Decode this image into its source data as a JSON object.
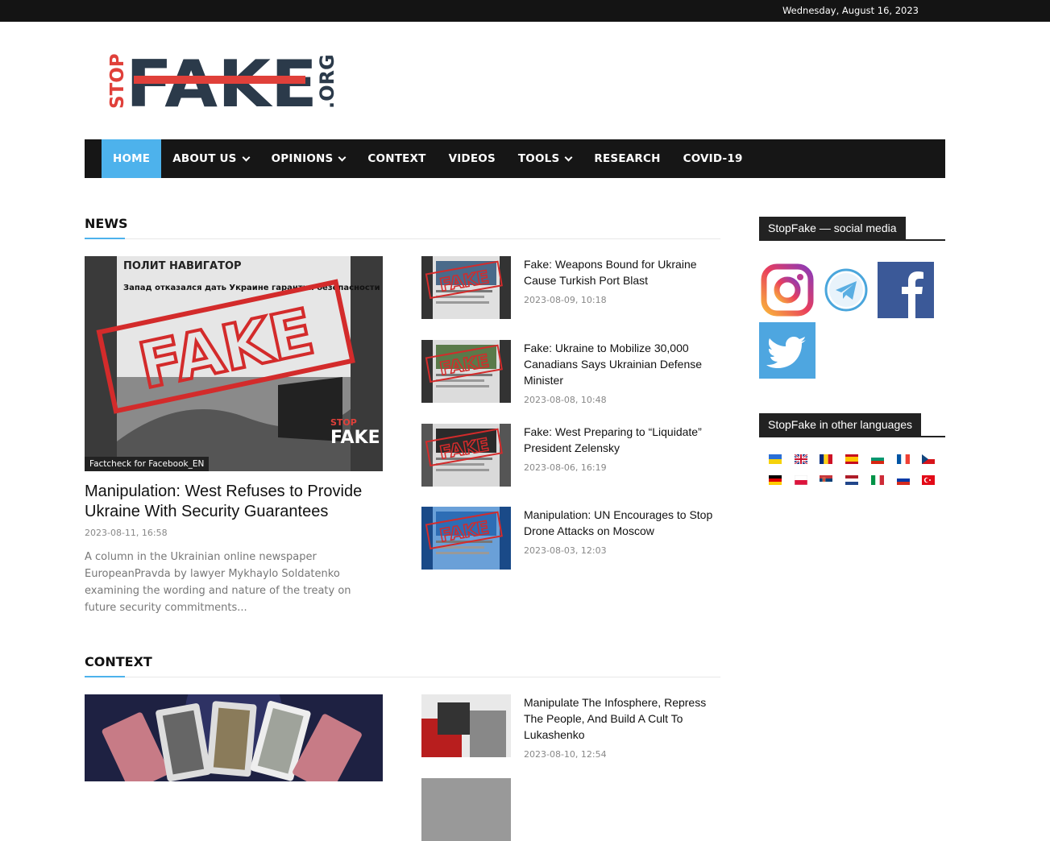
{
  "topbar": {
    "date": "Wednesday, August 16, 2023"
  },
  "logo": {
    "stop": "STOP",
    "fake": "FAKE",
    "org": ".ORG"
  },
  "nav": [
    {
      "label": "HOME",
      "active": true,
      "dropdown": false
    },
    {
      "label": "ABOUT US",
      "active": false,
      "dropdown": true
    },
    {
      "label": "OPINIONS",
      "active": false,
      "dropdown": true
    },
    {
      "label": "CONTEXT",
      "active": false,
      "dropdown": false
    },
    {
      "label": "VIDEOS",
      "active": false,
      "dropdown": false
    },
    {
      "label": "TOOLS",
      "active": false,
      "dropdown": true
    },
    {
      "label": "RESEARCH",
      "active": false,
      "dropdown": false
    },
    {
      "label": "COVID-19",
      "active": false,
      "dropdown": false
    }
  ],
  "news": {
    "section_title": "NEWS",
    "featured": {
      "category": "Factcheck for Facebook_EN",
      "title": "Manipulation: West Refuses to Provide Ukraine With Security Guarantees",
      "date": "2023-08-11, 16:58",
      "excerpt": "A column in the Ukrainian online newspaper EuropeanPravda by lawyer Mykhaylo Soldatenko examining the wording and nature of the treaty on future security commitments...",
      "image_text": {
        "site": "ПОЛИТ НАВИГАТОР",
        "stamp": "FAKE",
        "headline": "Запад отказался дать Украине гарантии безопасности"
      }
    },
    "items": [
      {
        "title": "Fake: Weapons Bound for Ukraine Cause Turkish Port Blast",
        "date": "2023-08-09, 10:18"
      },
      {
        "title": "Fake: Ukraine to Mobilize 30,000 Canadians Says Ukrainian Defense Minister",
        "date": "2023-08-08, 10:48"
      },
      {
        "title": "Fake: West Preparing to “Liquidate” President Zelensky",
        "date": "2023-08-06, 16:19"
      },
      {
        "title": "Manipulation: UN Encourages to Stop Drone Attacks on Moscow",
        "date": "2023-08-03, 12:03"
      }
    ]
  },
  "context": {
    "section_title": "CONTEXT",
    "items": [
      {
        "title": "Manipulate The Infosphere, Repress The People, And Build A Cult To Lukashenko",
        "date": "2023-08-10, 12:54"
      }
    ]
  },
  "sidebar": {
    "social_title": "StopFake — social media",
    "languages_title": "StopFake in other languages",
    "social": [
      "instagram-icon",
      "telegram-icon",
      "facebook-icon",
      "twitter-icon"
    ],
    "flags": [
      "ukraine",
      "united-kingdom",
      "romania",
      "spain",
      "bulgaria",
      "france",
      "czech",
      "germany",
      "poland",
      "serbia",
      "netherlands",
      "italy",
      "russia",
      "turkey"
    ]
  },
  "colors": {
    "accent": "#4db2ec",
    "nav_bg": "#161616",
    "logo_red": "#e0403a",
    "logo_dark": "#2b3a4a"
  }
}
